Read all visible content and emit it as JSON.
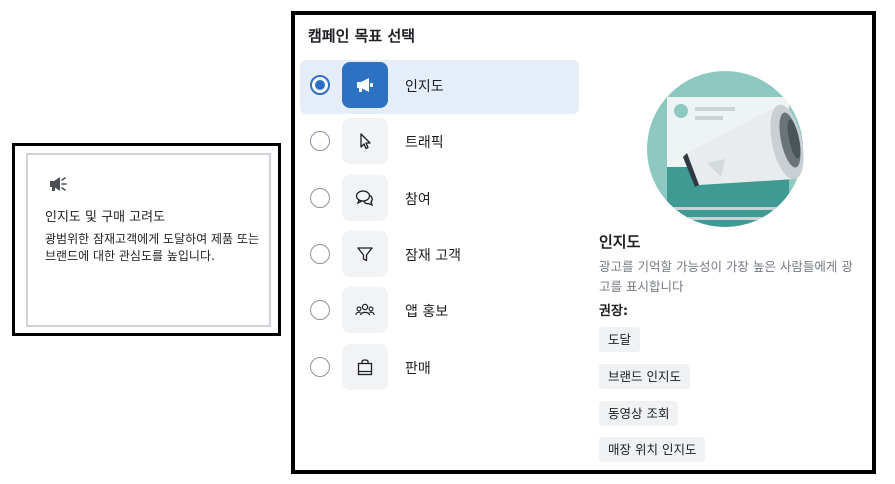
{
  "left_card": {
    "icon": "megaphone-icon",
    "title": "인지도 및 구매 고려도",
    "description": "광범위한 잠재고객에게 도달하여 제품 또는 브랜드에 대한 관심도를 높입니다."
  },
  "panel": {
    "title": "캠페인 목표 선택",
    "options": [
      {
        "label": "인지도",
        "icon": "megaphone-icon",
        "selected": true
      },
      {
        "label": "트래픽",
        "icon": "cursor-icon",
        "selected": false
      },
      {
        "label": "참여",
        "icon": "chat-bubbles-icon",
        "selected": false
      },
      {
        "label": "잠재 고객",
        "icon": "funnel-icon",
        "selected": false
      },
      {
        "label": "앱 홍보",
        "icon": "people-icon",
        "selected": false
      },
      {
        "label": "판매",
        "icon": "shopping-bag-icon",
        "selected": false
      }
    ],
    "detail": {
      "title": "인지도",
      "description": "광고를 기억할 가능성이 가장 높은 사람들에게 광고를 표시합니다",
      "recommended_label": "권장:",
      "tags": [
        "도달",
        "브랜드 인지도",
        "동영상 조회",
        "매장 위치 인지도"
      ]
    }
  },
  "colors": {
    "accent": "#2d72c2",
    "selected_bg": "#e4edf8",
    "illustration_teal": "#8ec9c1"
  }
}
